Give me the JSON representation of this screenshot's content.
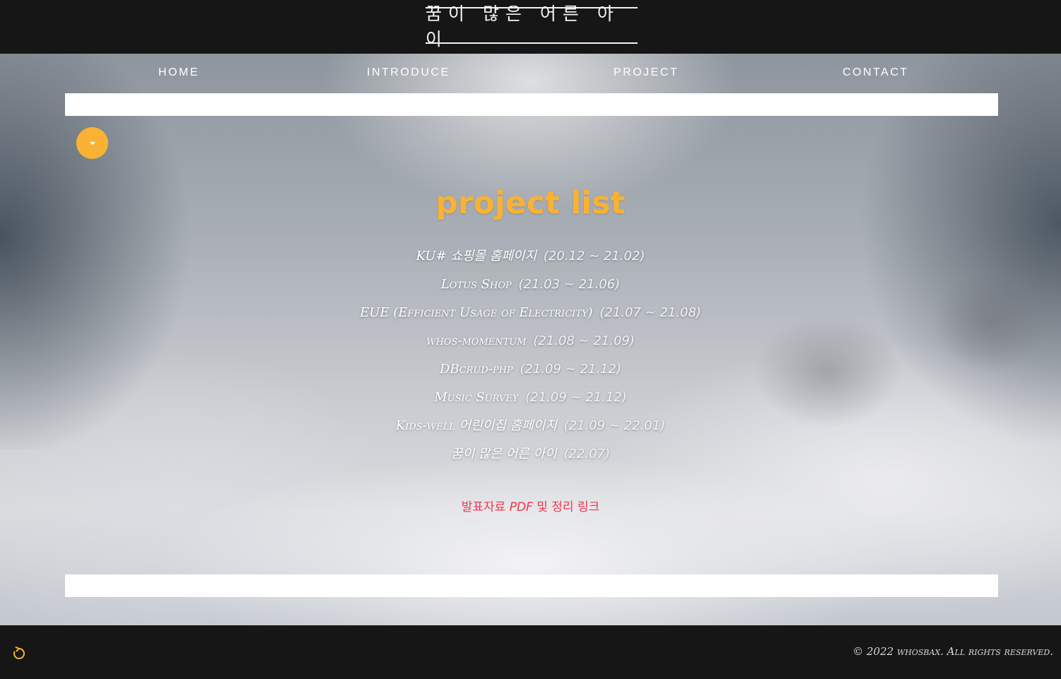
{
  "header": {
    "logo_text": "꿈이 많은 어른 아이"
  },
  "nav": {
    "items": [
      {
        "label": "HOME"
      },
      {
        "label": "INTRODUCE"
      },
      {
        "label": "PROJECT"
      },
      {
        "label": "CONTACT"
      }
    ]
  },
  "main": {
    "title": "project list",
    "projects": [
      {
        "name": "KU# 쇼핑몰 홈페이지",
        "date": "(20.12 ~ 21.02)"
      },
      {
        "name": "Lotus Shop",
        "date": "(21.03 ~ 21.06)"
      },
      {
        "name": "EUE (Efficient Usage of Electricity)",
        "date": "(21.07 ~ 21.08)"
      },
      {
        "name": "whos-momentum",
        "date": "(21.08 ~ 21.09)"
      },
      {
        "name": "DBcrud-php",
        "date": "(21.09 ~ 21.12)"
      },
      {
        "name": "Music Survey",
        "date": "(21.09 ~ 21.12)"
      },
      {
        "name": "Kids-well 어린이집 홈페이지",
        "date": "(21.09 ~ 22.01)"
      },
      {
        "name": "꿈이 많은 어른 아이",
        "date": "(22.07)"
      }
    ],
    "pdf_link_pre": "발표자료 ",
    "pdf_link_em": "PDF",
    "pdf_link_post": " 및 정리 링크"
  },
  "footer": {
    "copyright": "© 2022 whosbax. All rights reserved."
  },
  "icons": {
    "toggle": "caret-down-icon",
    "refresh": "refresh-icon"
  },
  "colors": {
    "accent": "#f9b233",
    "link": "#f0354f",
    "bar": "#161616"
  }
}
